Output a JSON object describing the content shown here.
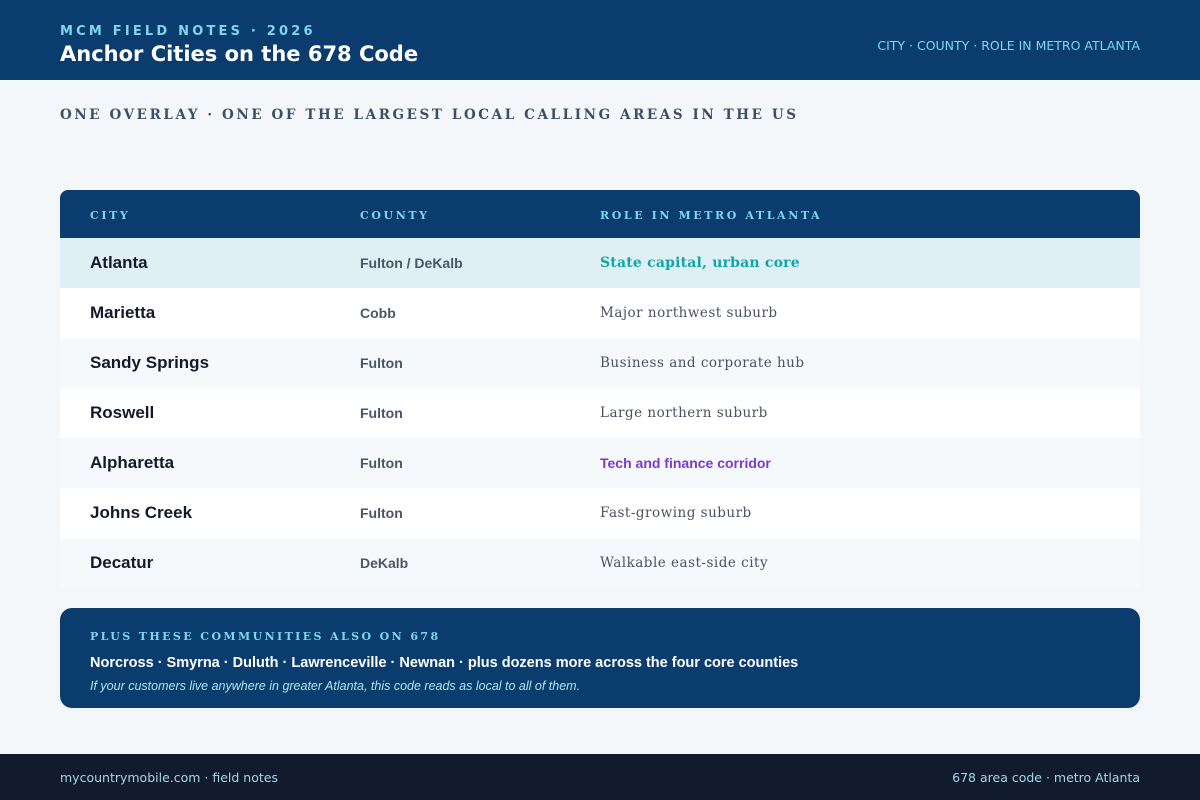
{
  "header": {
    "eyebrow": "MCM FIELD NOTES · 2026",
    "title": "Anchor Cities on the 678 Code",
    "tagline": "CITY · COUNTY · ROLE IN METRO ATLANTA"
  },
  "subtitle": "ONE OVERLAY · ONE OF THE LARGEST LOCAL CALLING AREAS IN THE US",
  "table": {
    "columns": [
      "CITY",
      "COUNTY",
      "ROLE IN METRO ATLANTA"
    ],
    "rows": [
      {
        "city": "Atlanta",
        "county": "Fulton / DeKalb",
        "role": "State capital, urban core"
      },
      {
        "city": "Marietta",
        "county": "Cobb",
        "role": "Major northwest suburb"
      },
      {
        "city": "Sandy Springs",
        "county": "Fulton",
        "role": "Business and corporate hub"
      },
      {
        "city": "Roswell",
        "county": "Fulton",
        "role": "Large northern suburb"
      },
      {
        "city": "Alpharetta",
        "county": "Fulton",
        "role": "Tech and finance corridor"
      },
      {
        "city": "Johns Creek",
        "county": "Fulton",
        "role": "Fast-growing suburb"
      },
      {
        "city": "Decatur",
        "county": "DeKalb",
        "role": "Walkable east-side city"
      }
    ]
  },
  "callout": {
    "title": "PLUS THESE COMMUNITIES ALSO ON 678",
    "list": "Norcross · Smyrna · Duluth · Lawrenceville · Newnan · plus dozens more across the four core counties",
    "note": "If your customers live anywhere in greater Atlanta, this code reads as local to all of them."
  },
  "footer": {
    "left": "mycountrymobile.com · field notes",
    "right": "678 area code · metro Atlanta"
  },
  "colors": {
    "brand_navy": "#0a3d6e",
    "accent_cyan": "#7fd6ee",
    "accent_teal": "#12a5a8",
    "accent_purple": "#7a3cc8",
    "footer_dark": "#111b2d"
  }
}
